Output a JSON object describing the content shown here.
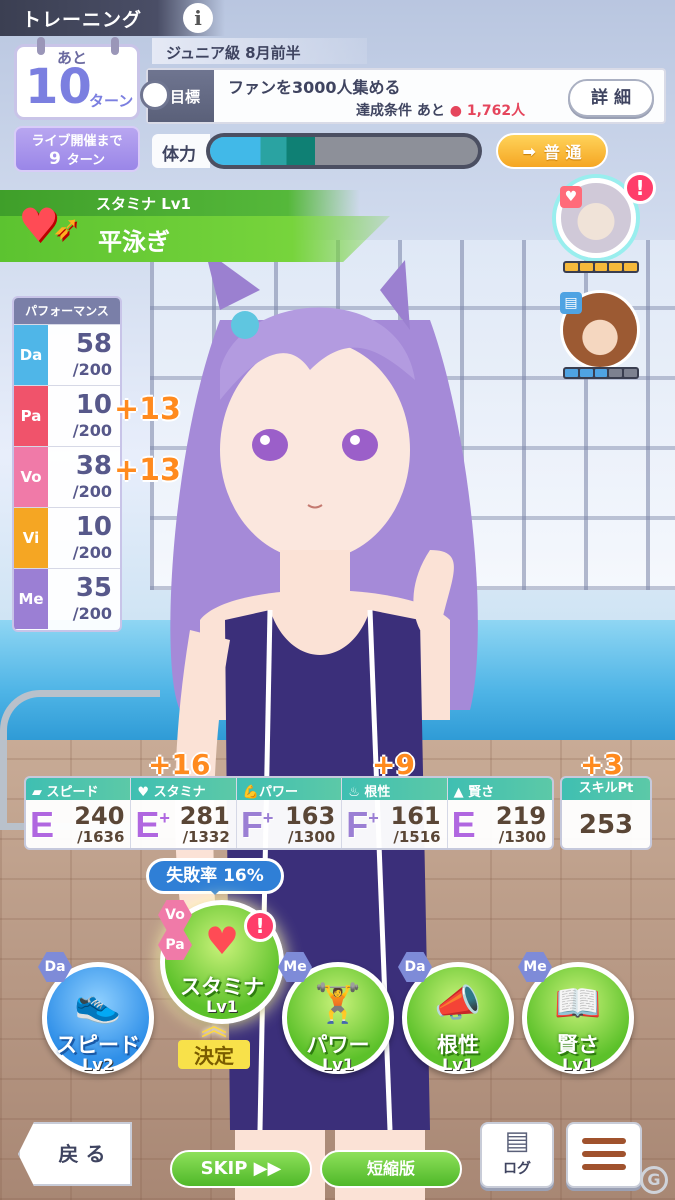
{
  "header": {
    "title": "トレーニング",
    "info_icon": "i"
  },
  "turn": {
    "prefix": "あと",
    "value": "10",
    "suffix": "ターン"
  },
  "live": {
    "line1": "ライブ開催まで",
    "value": "9",
    "suffix": "ターン"
  },
  "period": "ジュニア級 8月前半",
  "goal": {
    "label": "目標",
    "text": "ファンを3000人集める",
    "sub_prefix": "達成条件 あと",
    "sub_value": "1,762人",
    "detail_button": "詳 細"
  },
  "stamina": {
    "label": "体力",
    "fill_fraction": 0.39
  },
  "mood": {
    "label": "普 通",
    "arrow": "➡"
  },
  "training_banner": {
    "type": "スタミナ Lv1",
    "name": "平泳ぎ"
  },
  "performance": {
    "title": "パフォーマンス",
    "rows": [
      {
        "tag": "Da",
        "value": "58",
        "max": "/200",
        "color": "#4fb6e8",
        "bonus": ""
      },
      {
        "tag": "Pa",
        "value": "10",
        "max": "/200",
        "color": "#f0536b",
        "bonus": "+13"
      },
      {
        "tag": "Vo",
        "value": "38",
        "max": "/200",
        "color": "#f07aa8",
        "bonus": "+13"
      },
      {
        "tag": "Vi",
        "value": "10",
        "max": "/200",
        "color": "#f5a623",
        "bonus": ""
      },
      {
        "tag": "Me",
        "value": "35",
        "max": "/200",
        "color": "#9b7fd4",
        "bonus": ""
      }
    ]
  },
  "stats": [
    {
      "icon": "shoe-icon",
      "label": "スピード",
      "rank": "E",
      "plus": "",
      "value": "240",
      "max": "/1636",
      "bonus": ""
    },
    {
      "icon": "heart-icon",
      "label": "スタミナ",
      "rank": "E",
      "plus": "+",
      "value": "281",
      "max": "/1332",
      "bonus": "+16"
    },
    {
      "icon": "muscle-icon",
      "label": "パワー",
      "rank": "F",
      "plus": "+",
      "value": "163",
      "max": "/1300",
      "bonus": ""
    },
    {
      "icon": "flame-icon",
      "label": "根性",
      "rank": "F",
      "plus": "+",
      "value": "161",
      "max": "/1516",
      "bonus": "+9"
    },
    {
      "icon": "grad-cap-icon",
      "label": "賢さ",
      "rank": "E",
      "plus": "",
      "value": "219",
      "max": "/1300",
      "bonus": ""
    }
  ],
  "skill": {
    "label": "スキルPt",
    "value": "253",
    "bonus": "+3"
  },
  "failure": {
    "label": "失敗率 16%"
  },
  "trainings": [
    {
      "name": "スピード",
      "level": "Lv2",
      "tag": "Da",
      "icon": "sneakers-icon"
    },
    {
      "name": "スタミナ",
      "level": "Lv1",
      "tags": [
        "Vo",
        "Pa"
      ],
      "icon": "heart-arrow-icon",
      "selected": true
    },
    {
      "name": "パワー",
      "level": "Lv1",
      "tag": "Me",
      "icon": "dumbbell-icon"
    },
    {
      "name": "根性",
      "level": "Lv1",
      "tag": "Da",
      "icon": "megaphone-icon"
    },
    {
      "name": "賢さ",
      "level": "Lv1",
      "tag": "Me",
      "icon": "book-icon"
    }
  ],
  "decide": "決定",
  "bottom": {
    "back": "戻 る",
    "skip": "SKIP ▶▶",
    "short": "短縮版",
    "log": "ログ"
  },
  "colors": {
    "accent_green": "#5cc330",
    "accent_blue": "#2f8fe8",
    "bonus_orange": "#ff8a1e",
    "stamina_blue": "#41b9e8"
  }
}
